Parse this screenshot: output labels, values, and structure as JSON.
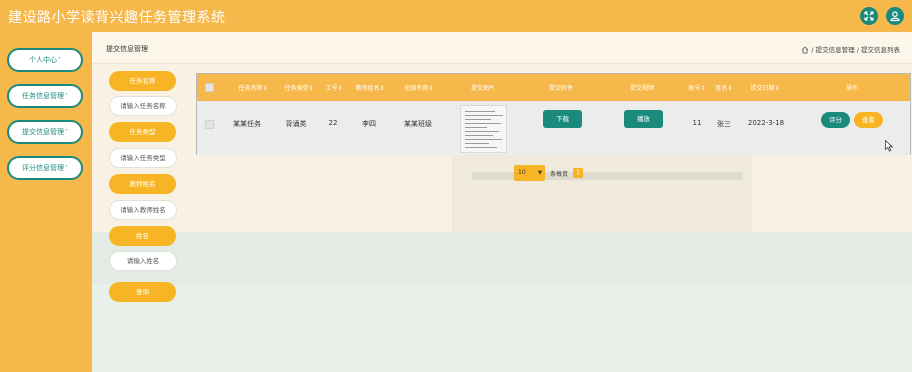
{
  "app": {
    "title": "建设路小学读背兴趣任务管理系统"
  },
  "header_icons": [
    "expand-icon",
    "user-icon"
  ],
  "sidebar": {
    "items": [
      {
        "label": "个人中心",
        "caret": "˅"
      },
      {
        "label": "任务信息管理",
        "caret": "˅"
      },
      {
        "label": "提交信息管理",
        "caret": "˅"
      },
      {
        "label": "评分信息管理",
        "caret": "˅"
      }
    ]
  },
  "page": {
    "title": "提交信息管理",
    "breadcrumb": "/ 提交信息管理 / 提交信息列表"
  },
  "search": {
    "fields": [
      {
        "label": "任务名称",
        "placeholder": "请输入任务名称"
      },
      {
        "label": "任务类型",
        "placeholder": "请输入任务类型"
      },
      {
        "label": "教师姓名",
        "placeholder": "请输入教师姓名"
      },
      {
        "label": "姓名",
        "placeholder": "请输入姓名"
      }
    ],
    "button": "查询"
  },
  "table": {
    "columns": [
      "任务名称",
      "任务类型",
      "工号",
      "教师姓名",
      "班级名称",
      "提交图片",
      "提交附件",
      "提交视频",
      "账号",
      "姓名",
      "提交日期",
      "操作"
    ],
    "rows": [
      {
        "task_name": "某某任务",
        "task_type": "背诵类",
        "job_no": "22",
        "teacher": "李四",
        "class_name": "某某班级",
        "download_label": "下载",
        "play_label": "播放",
        "account": "11",
        "name": "张三",
        "date": "2022-3-18",
        "score_label": "评分",
        "view_label": "查看"
      }
    ]
  },
  "pagination": {
    "page_size": "10",
    "per_page_label": "条每页",
    "current_page": "1"
  },
  "colors": {
    "accent": "#f7b84b",
    "button_yellow": "#f7b525",
    "teal": "#1a8a7d"
  }
}
